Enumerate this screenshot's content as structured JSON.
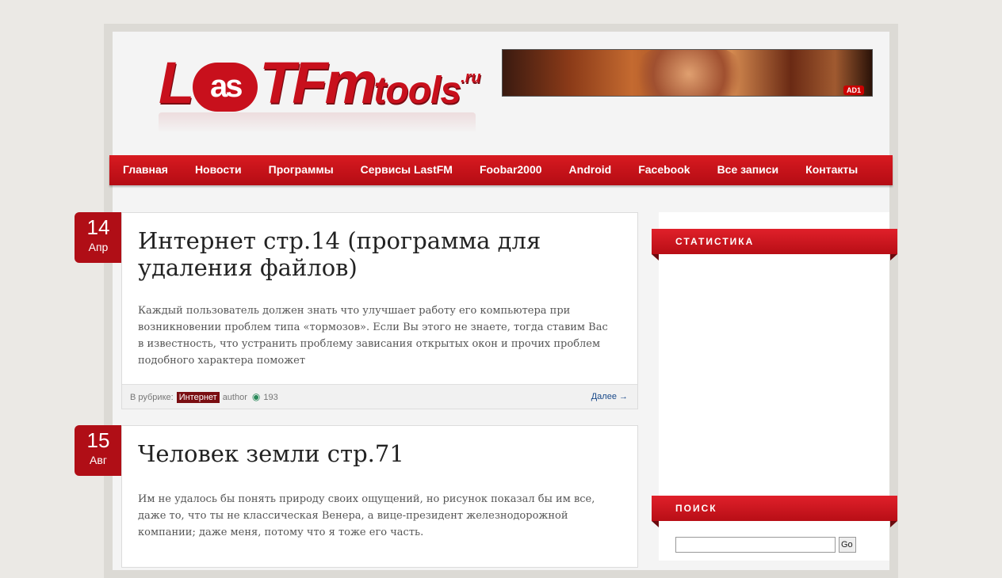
{
  "site": {
    "logo_text_l": "L",
    "logo_text_as": "as",
    "logo_text_t": "T",
    "logo_text_fm": "Fm",
    "logo_text_tools": "tools",
    "logo_text_ru": ".ru"
  },
  "banner": {
    "badge": "AD1"
  },
  "nav": {
    "items": [
      {
        "label": "Главная"
      },
      {
        "label": "Новости"
      },
      {
        "label": "Программы"
      },
      {
        "label": "Сервисы LastFM"
      },
      {
        "label": "Foobar2000"
      },
      {
        "label": "Android"
      },
      {
        "label": "Facebook"
      },
      {
        "label": "Все записи"
      },
      {
        "label": "Контакты"
      }
    ]
  },
  "posts": [
    {
      "day": "14",
      "month": "Апр",
      "title": "Интернет стр.14 (программа для удаления файлов)",
      "excerpt": "Каждый пользователь должен знать что улучшает работу его компьютера при возникновении проблем типа «тормозов». Если Вы этого не знаете, тогда ставим Вас в известность, что устранить проблему зависания открытых окон и прочих проблем подобного характера поможет",
      "category_label": "В рубрике:",
      "category": "Интернет",
      "author": "author",
      "views": "193",
      "more": "Далее →"
    },
    {
      "day": "15",
      "month": "Авг",
      "title": "Человек земли стр.71",
      "excerpt": "Им не удалось бы понять природу своих ощущений, но рисунок показал бы им все, даже то, что ты не классическая Венера, а вице-президент железнодорожной компании; даже меня, потому что я тоже его часть."
    }
  ],
  "sidebar": {
    "stats_title": "СТАТИСТИКА",
    "search_title": "ПОИСК",
    "search_button": "Go"
  },
  "icons": {
    "eye": "eye-icon"
  },
  "colors": {
    "brand_red": "#c8101c",
    "nav_red": "#d81a20",
    "date_red": "#b00e16"
  }
}
